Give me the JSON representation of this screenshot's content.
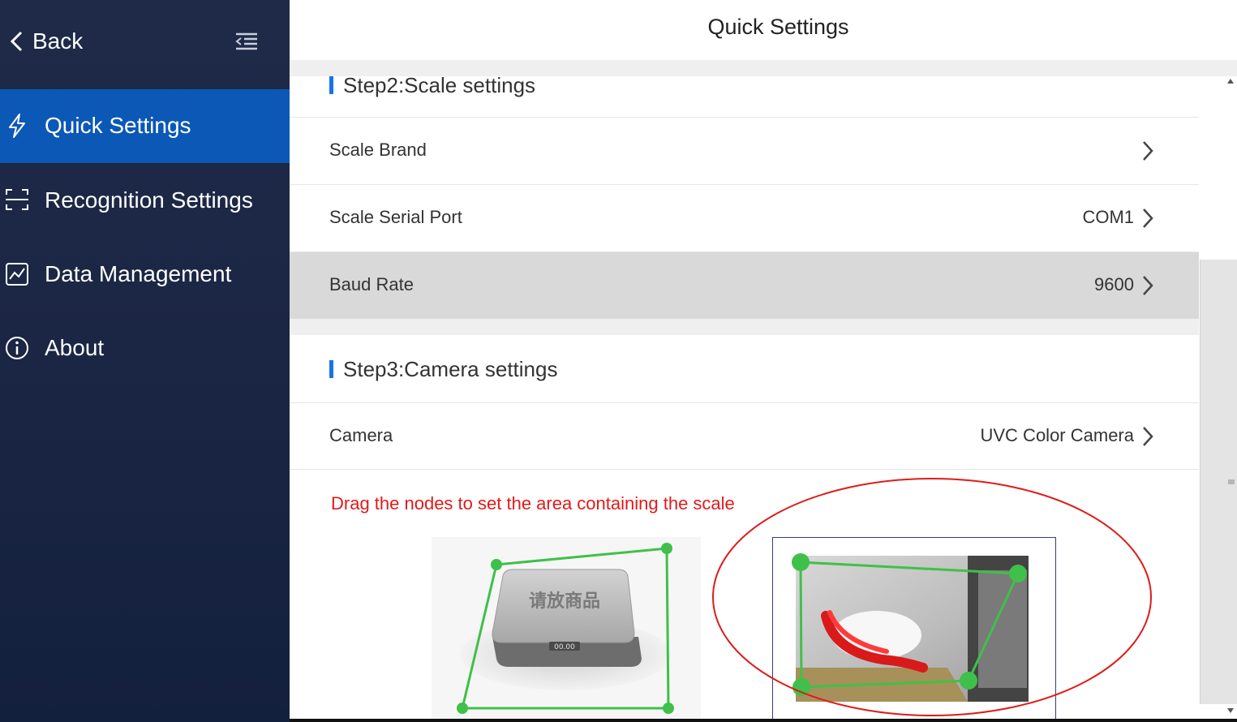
{
  "sidebar": {
    "back_label": "Back",
    "items": [
      {
        "label": "Quick Settings",
        "icon": "lightning-icon",
        "active": true
      },
      {
        "label": "Recognition Settings",
        "icon": "scan-icon",
        "active": false
      },
      {
        "label": "Data Management",
        "icon": "chart-icon",
        "active": false
      },
      {
        "label": "About",
        "icon": "info-icon",
        "active": false
      }
    ]
  },
  "header": {
    "title": "Quick Settings"
  },
  "step2": {
    "title": "Step2:Scale settings",
    "rows": [
      {
        "label": "Scale Brand",
        "value": ""
      },
      {
        "label": "Scale Serial Port",
        "value": "COM1"
      },
      {
        "label": "Baud Rate",
        "value": "9600"
      }
    ]
  },
  "step3": {
    "title": "Step3:Camera settings",
    "rows": [
      {
        "label": "Camera",
        "value": "UVC Color Camera"
      }
    ],
    "hint": "Drag the nodes to set the area containing the scale",
    "scale_text": "请放商品",
    "scale_display": "00.00"
  },
  "colors": {
    "sidebar_bg": "#1c2745",
    "active_bg": "#0b58b6",
    "accent_bar": "#1a73e8",
    "hint_red": "#e01b1b",
    "node_green": "#3fc04a",
    "selected_row": "#d9d9d9"
  }
}
